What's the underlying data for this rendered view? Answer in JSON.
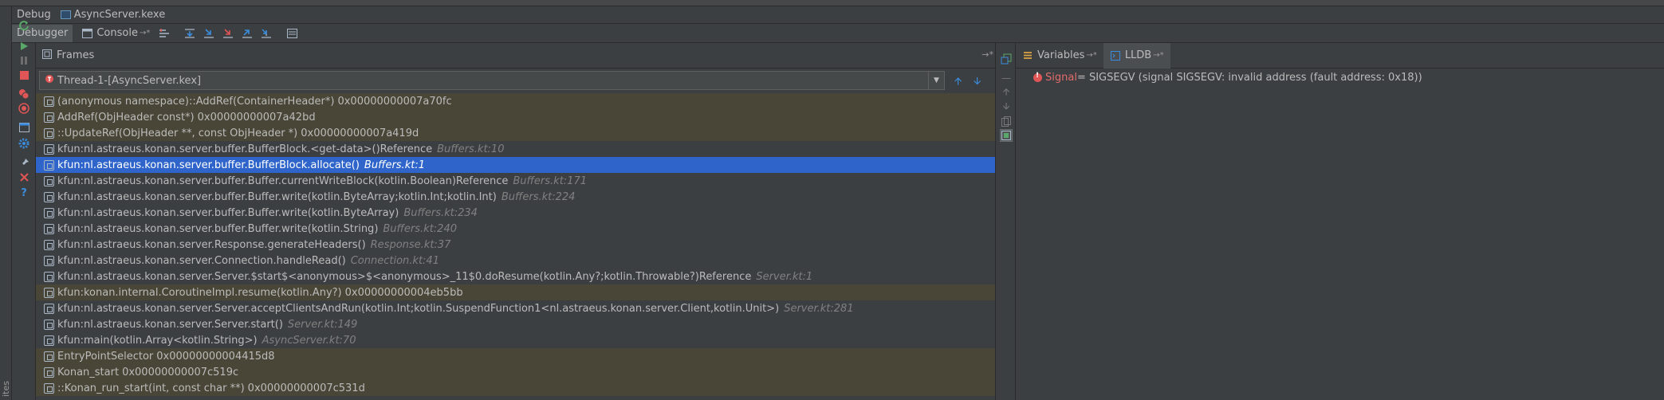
{
  "window": {
    "title_prefix": "Debug",
    "title_app": "AsyncServer.kexe"
  },
  "toolbar": {
    "tab_debugger": "Debugger",
    "tab_console": "Console",
    "console_pin": "→*"
  },
  "left_strip": {
    "label": "ites"
  },
  "frames_panel": {
    "title": "Frames",
    "pin": "→*",
    "thread_label": "Thread-1-[AsyncServer.kex]"
  },
  "frames": [
    {
      "func": "(anonymous namespace)::AddRef(ContainerHeader*)",
      "addr": "0x00000000007a70fc",
      "loc": "",
      "lib": true
    },
    {
      "func": "AddRef(ObjHeader const*)",
      "addr": "0x00000000007a42bd",
      "loc": "",
      "lib": true
    },
    {
      "func": "::UpdateRef(ObjHeader **, const ObjHeader *)",
      "addr": "0x00000000007a419d",
      "loc": "",
      "lib": true
    },
    {
      "func": "kfun:nl.astraeus.konan.server.buffer.BufferBlock.<get-data>()Reference",
      "addr": "",
      "loc": "Buffers.kt:10",
      "lib": false
    },
    {
      "func": "kfun:nl.astraeus.konan.server.buffer.BufferBlock.allocate()",
      "addr": "",
      "loc": "Buffers.kt:1",
      "lib": false,
      "selected": true
    },
    {
      "func": "kfun:nl.astraeus.konan.server.buffer.Buffer.currentWriteBlock(kotlin.Boolean)Reference",
      "addr": "",
      "loc": "Buffers.kt:171",
      "lib": false
    },
    {
      "func": "kfun:nl.astraeus.konan.server.buffer.Buffer.write(kotlin.ByteArray;kotlin.Int;kotlin.Int)",
      "addr": "",
      "loc": "Buffers.kt:224",
      "lib": false
    },
    {
      "func": "kfun:nl.astraeus.konan.server.buffer.Buffer.write(kotlin.ByteArray)",
      "addr": "",
      "loc": "Buffers.kt:234",
      "lib": false
    },
    {
      "func": "kfun:nl.astraeus.konan.server.buffer.Buffer.write(kotlin.String)",
      "addr": "",
      "loc": "Buffers.kt:240",
      "lib": false
    },
    {
      "func": "kfun:nl.astraeus.konan.server.Response.generateHeaders()",
      "addr": "",
      "loc": "Response.kt:37",
      "lib": false
    },
    {
      "func": "kfun:nl.astraeus.konan.server.Connection.handleRead()",
      "addr": "",
      "loc": "Connection.kt:41",
      "lib": false
    },
    {
      "func": "kfun:nl.astraeus.konan.server.Server.$start$<anonymous>$<anonymous>_11$0.doResume(kotlin.Any?;kotlin.Throwable?)Reference",
      "addr": "",
      "loc": "Server.kt:1",
      "lib": false
    },
    {
      "func": "kfun:konan.internal.CoroutineImpl.resume(kotlin.Any?)",
      "addr": "0x00000000004eb5bb",
      "loc": "",
      "lib": true
    },
    {
      "func": "kfun:nl.astraeus.konan.server.Server.acceptClientsAndRun(kotlin.Int;kotlin.SuspendFunction1<nl.astraeus.konan.server.Client,kotlin.Unit>)",
      "addr": "",
      "loc": "Server.kt:281",
      "lib": false
    },
    {
      "func": "kfun:nl.astraeus.konan.server.Server.start()",
      "addr": "",
      "loc": "Server.kt:149",
      "lib": false
    },
    {
      "func": "kfun:main(kotlin.Array<kotlin.String>)",
      "addr": "",
      "loc": "AsyncServer.kt:70",
      "lib": false
    },
    {
      "func": "EntryPointSelector",
      "addr": "0x00000000004415d8",
      "loc": "",
      "lib": true
    },
    {
      "func": "Konan_start",
      "addr": "0x00000000007c519c",
      "loc": "",
      "lib": true
    },
    {
      "func": "::Konan_run_start(int, const char **)",
      "addr": "0x00000000007c531d",
      "loc": "",
      "lib": true
    }
  ],
  "vars_panel": {
    "tab_variables": "Variables",
    "tab_lldb": "LLDB",
    "pin": "→*",
    "signal_name": "Signal",
    "signal_value": " = SIGSEGV (signal SIGSEGV: invalid address (fault address: 0x18))"
  },
  "colors": {
    "background": "#3c3f41",
    "selected_row": "#2f65ca",
    "library_row": "#4a4637",
    "accent_blue": "#3a8dde",
    "error_red": "#e05555"
  }
}
